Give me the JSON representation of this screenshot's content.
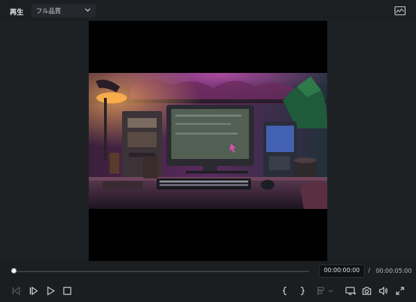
{
  "header": {
    "play_label": "再生",
    "quality": {
      "selected": "フル品質"
    },
    "scope_icon": "waveform-scope-icon"
  },
  "player": {
    "progress": 0.0,
    "current_time": "00:00:00:00",
    "separator": "/",
    "duration": "00:00:05:00"
  },
  "controls": {
    "icons": [
      "previous-frame-icon",
      "next-frame-icon",
      "play-icon",
      "stop-icon",
      "mark-in-icon",
      "mark-out-icon",
      "add-marker-icon",
      "display-dropdown-icon",
      "snapshot-icon",
      "volume-icon",
      "fullscreen-icon"
    ]
  },
  "colors": {
    "background": "#1a1e21",
    "panel": "#1d2124",
    "video_bg": "#000000",
    "icon": "#c9cdd0",
    "icon_disabled": "#555a5f"
  }
}
